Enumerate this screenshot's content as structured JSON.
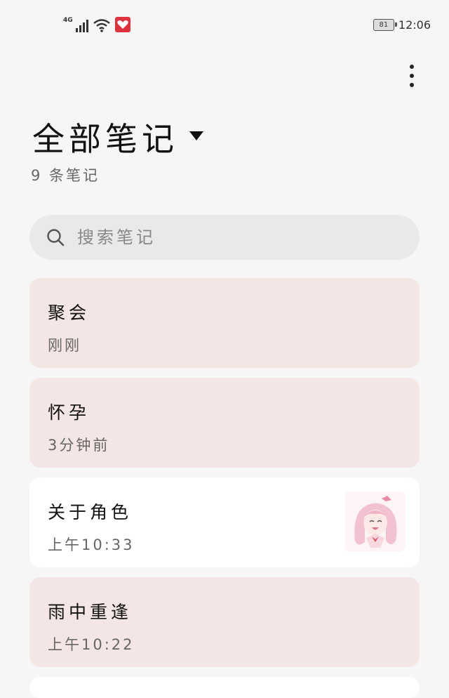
{
  "status_bar": {
    "network": "4G",
    "battery": "81",
    "time": "12:06"
  },
  "header": {
    "title": "全部笔记",
    "count": "9 条笔记"
  },
  "search": {
    "placeholder": "搜索笔记"
  },
  "notes": [
    {
      "title": "聚会",
      "time": "刚刚"
    },
    {
      "title": "怀孕",
      "time": "3分钟前"
    },
    {
      "title": "关于角色",
      "time": "上午10:33"
    },
    {
      "title": "雨中重逢",
      "time": "上午10:22"
    }
  ],
  "colors": {
    "background": "#f6f6f6",
    "note_pink": "#f4e6e4",
    "note_white": "#ffffff",
    "search_bg": "#e9e9e9",
    "accent_red": "#e0323c"
  }
}
